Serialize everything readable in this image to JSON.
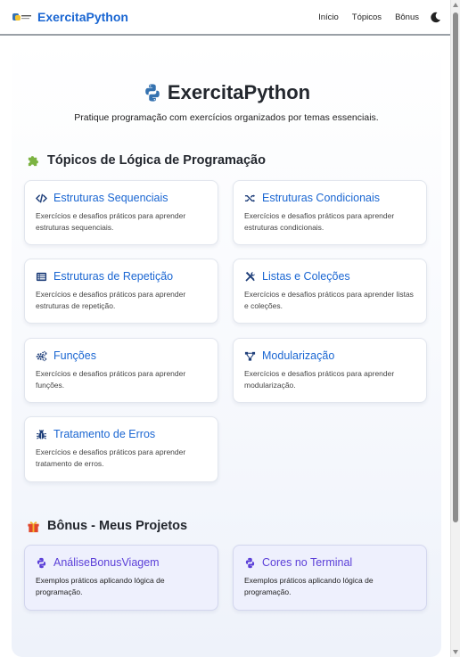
{
  "navbar": {
    "brand_text": "ExercitaPython",
    "links": [
      "Início",
      "Tópicos",
      "Bônus"
    ]
  },
  "hero": {
    "title": "ExercitaPython",
    "subtitle": "Pratique programação com exercícios organizados por temas essenciais."
  },
  "topics_section": {
    "heading": "Tópicos de Lógica de Programação",
    "icon": "puzzle-icon",
    "cards": [
      {
        "title": "Estruturas Sequenciais",
        "icon": "code-icon",
        "description": "Exercícios e desafios práticos para aprender estruturas sequenciais."
      },
      {
        "title": "Estruturas Condicionais",
        "icon": "shuffle-icon",
        "description": "Exercícios e desafios práticos para aprender estruturas condicionais."
      },
      {
        "title": "Estruturas de Repetição",
        "icon": "list-icon",
        "description": "Exercícios e desafios práticos para aprender estruturas de repetição."
      },
      {
        "title": "Listas e Coleções",
        "icon": "tools-icon",
        "description": "Exercícios e desafios práticos para aprender listas e coleções."
      },
      {
        "title": "Funções",
        "icon": "gears-icon",
        "description": "Exercícios e desafios práticos para aprender funções."
      },
      {
        "title": "Modularização",
        "icon": "diagram-icon",
        "description": "Exercícios e desafios práticos para aprender modularização."
      },
      {
        "title": "Tratamento de Erros",
        "icon": "bug-icon",
        "description": "Exercícios e desafios práticos para aprender tratamento de erros."
      }
    ]
  },
  "bonus_section": {
    "heading": "Bônus - Meus Projetos",
    "icon": "gift-icon",
    "cards": [
      {
        "title": "AnáliseBonusViagem",
        "icon": "python-icon",
        "description": "Exemplos práticos aplicando lógica de programação."
      },
      {
        "title": "Cores no Terminal",
        "icon": "python-icon",
        "description": "Exemplos práticos aplicando lógica de programação."
      }
    ]
  },
  "colors": {
    "accent_blue": "#1a66d2",
    "bonus_purple": "#5b3fd8",
    "puzzle_green": "#7cb342",
    "gift_red": "#e0452b",
    "gift_yellow": "#f5b82e"
  }
}
